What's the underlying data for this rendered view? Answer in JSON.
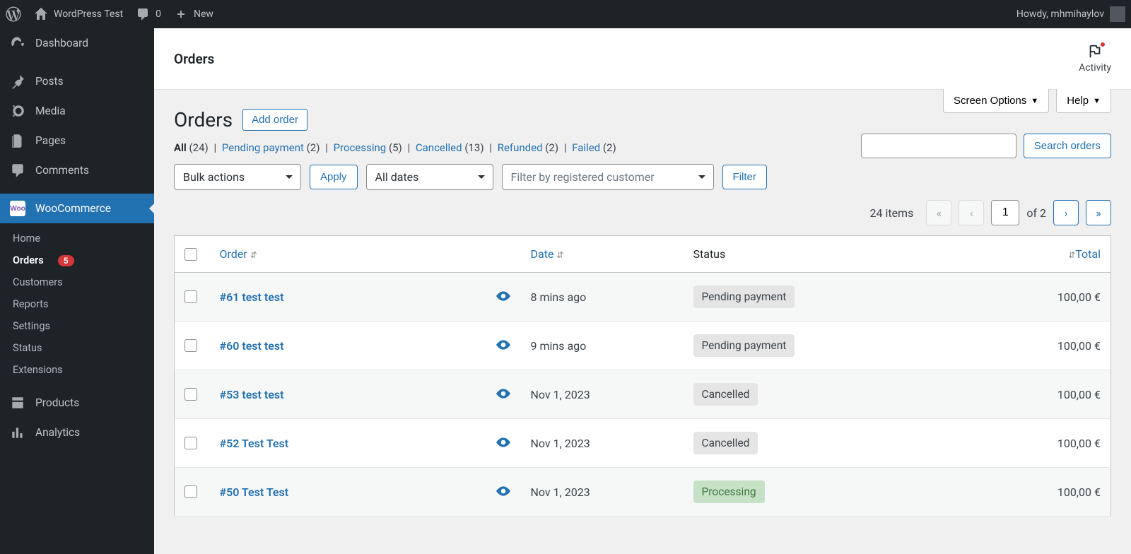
{
  "adminbar": {
    "site_title": "WordPress Test",
    "comments_count": "0",
    "new_label": "New",
    "howdy": "Howdy, mhmihaylov"
  },
  "sidebar": {
    "dashboard": "Dashboard",
    "posts": "Posts",
    "media": "Media",
    "pages": "Pages",
    "comments": "Comments",
    "woocommerce": "WooCommerce",
    "products": "Products",
    "analytics": "Analytics",
    "sub": {
      "home": "Home",
      "orders": "Orders",
      "orders_badge": "5",
      "customers": "Customers",
      "reports": "Reports",
      "settings": "Settings",
      "status": "Status",
      "extensions": "Extensions"
    }
  },
  "header": {
    "title": "Orders",
    "activity": "Activity"
  },
  "tabs": {
    "screen_options": "Screen Options",
    "help": "Help"
  },
  "heading": {
    "title": "Orders",
    "add_order": "Add order"
  },
  "subsub": {
    "all_label": "All",
    "all_count": "(24)",
    "pending_label": "Pending payment",
    "pending_count": "(2)",
    "processing_label": "Processing",
    "processing_count": "(5)",
    "cancelled_label": "Cancelled",
    "cancelled_count": "(13)",
    "refunded_label": "Refunded",
    "refunded_count": "(2)",
    "failed_label": "Failed",
    "failed_count": "(2)"
  },
  "actions": {
    "bulk": "Bulk actions",
    "apply": "Apply",
    "all_dates": "All dates",
    "filter_customer": "Filter by registered customer",
    "filter": "Filter",
    "search_orders": "Search orders"
  },
  "pager": {
    "count": "24 items",
    "page": "1",
    "of": "of 2"
  },
  "table": {
    "th_order": "Order",
    "th_date": "Date",
    "th_status": "Status",
    "th_total": "Total",
    "rows": [
      {
        "order": "#61 test test",
        "date": "8 mins ago",
        "status_label": "Pending payment",
        "status_class": "pending",
        "total": "100,00 €"
      },
      {
        "order": "#60 test test",
        "date": "9 mins ago",
        "status_label": "Pending payment",
        "status_class": "pending",
        "total": "100,00 €"
      },
      {
        "order": "#53 test test",
        "date": "Nov 1, 2023",
        "status_label": "Cancelled",
        "status_class": "cancelled",
        "total": "100,00 €"
      },
      {
        "order": "#52 Test Test",
        "date": "Nov 1, 2023",
        "status_label": "Cancelled",
        "status_class": "cancelled",
        "total": "100,00 €"
      },
      {
        "order": "#50 Test Test",
        "date": "Nov 1, 2023",
        "status_label": "Processing",
        "status_class": "processing",
        "total": "100,00 €"
      }
    ]
  }
}
